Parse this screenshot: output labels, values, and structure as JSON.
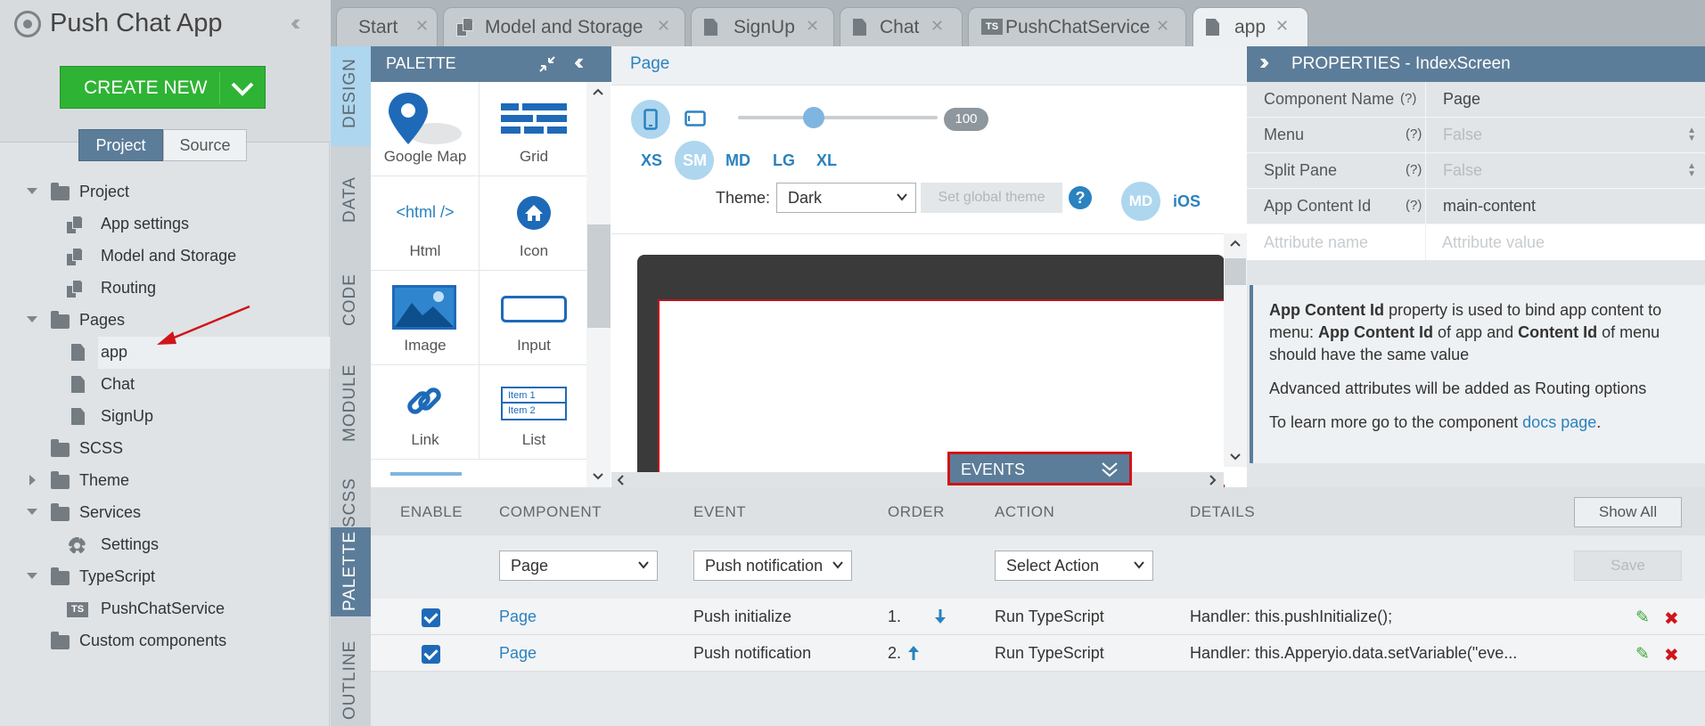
{
  "app": {
    "title": "Push Chat App",
    "create_new_label": "CREATE NEW",
    "seg_project": "Project",
    "seg_source": "Source"
  },
  "tree": [
    {
      "label": "Project"
    },
    {
      "label": "App settings"
    },
    {
      "label": "Model and Storage"
    },
    {
      "label": "Routing"
    },
    {
      "label": "Pages"
    },
    {
      "label": "app"
    },
    {
      "label": "Chat"
    },
    {
      "label": "SignUp"
    },
    {
      "label": "SCSS"
    },
    {
      "label": "Theme"
    },
    {
      "label": "Services"
    },
    {
      "label": "Settings"
    },
    {
      "label": "TypeScript"
    },
    {
      "label": "PushChatService"
    },
    {
      "label": "Custom components"
    }
  ],
  "tabs": [
    {
      "label": "Start"
    },
    {
      "label": "Model and Storage"
    },
    {
      "label": "SignUp"
    },
    {
      "label": "Chat"
    },
    {
      "label": "PushChatService",
      "badge": "TS"
    },
    {
      "label": "app"
    }
  ],
  "side_tabs": [
    "DESIGN",
    "DATA",
    "CODE",
    "MODULE",
    "SCSS",
    "PALETTE",
    "OUTLINE"
  ],
  "palette": {
    "title": "PALETTE",
    "items": [
      {
        "label": "Google Map"
      },
      {
        "label": "Grid"
      },
      {
        "label": "Html",
        "glyph": "<html />"
      },
      {
        "label": "Icon"
      },
      {
        "label": "Image"
      },
      {
        "label": "Input"
      },
      {
        "label": "Link"
      },
      {
        "label": "List",
        "glyph_items": [
          "Item 1",
          "Item 2"
        ]
      }
    ]
  },
  "design": {
    "breadcrumb": "Page",
    "zoom_value": "100",
    "zoom_fraction": 0.38,
    "breakpoints": [
      "XS",
      "SM",
      "MD",
      "LG",
      "XL"
    ],
    "active_breakpoint": "SM",
    "theme_label": "Theme:",
    "theme_value": "Dark",
    "set_global_theme": "Set global theme",
    "help": "?",
    "platform_md": "MD",
    "platform_ios": "iOS",
    "events_label": "EVENTS"
  },
  "properties": {
    "title": "PROPERTIES - IndexScreen",
    "rows": [
      {
        "key": "Component Name",
        "q": "(?)",
        "value": "Page"
      },
      {
        "key": "Menu",
        "q": "(?)",
        "value": "False"
      },
      {
        "key": "Split Pane",
        "q": "(?)",
        "value": "False"
      },
      {
        "key": "App Content Id",
        "q": "(?)",
        "value": "main-content"
      }
    ],
    "attr_name_ph": "Attribute name",
    "attr_value_ph": "Attribute value",
    "info": {
      "p1_b1": "App Content Id",
      "p1_t1": " property is used to bind app content to menu: ",
      "p1_b2": "App Content Id",
      "p1_t2": " of app and ",
      "p1_b3": "Content Id",
      "p1_t3": " of menu should have the same value",
      "p2": "Advanced attributes will be added as Routing options",
      "p3_t1": "To learn more go to the component ",
      "p3_link": "docs page",
      "p3_t2": "."
    }
  },
  "events": {
    "headers": {
      "enable": "ENABLE",
      "component": "COMPONENT",
      "event": "EVENT",
      "order": "ORDER",
      "action": "ACTION",
      "details": "DETAILS"
    },
    "show_all": "Show All",
    "save": "Save",
    "filter": {
      "component": "Page",
      "event": "Push notification",
      "action": "Select Action"
    },
    "rows": [
      {
        "component": "Page",
        "event": "Push initialize",
        "order": "1.",
        "arrow": "down",
        "action": "Run TypeScript",
        "details": "Handler: this.pushInitialize();"
      },
      {
        "component": "Page",
        "event": "Push notification",
        "order": "2.",
        "arrow": "up",
        "action": "Run TypeScript",
        "details": "Handler: this.Apperyio.data.setVariable(\"eve..."
      }
    ]
  },
  "colors": {
    "accent": "#5c7d99",
    "create_green": "#2fb334",
    "link_blue": "#2a82bf",
    "highlight_red": "#d0141a"
  }
}
